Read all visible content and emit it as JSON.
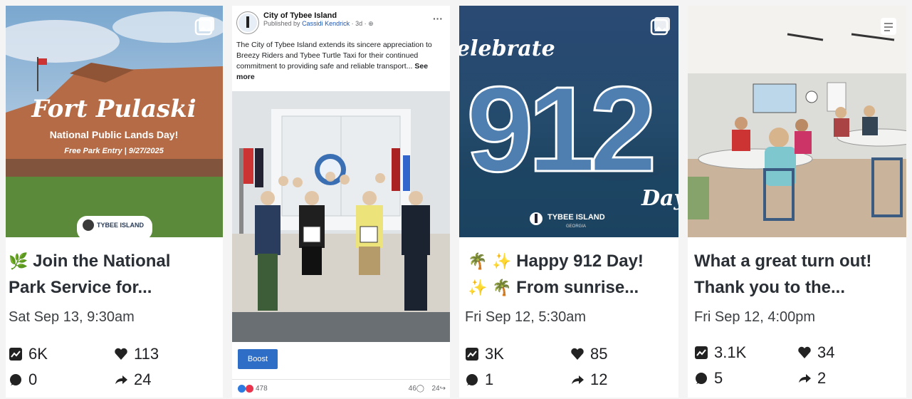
{
  "cards": [
    {
      "image_title": "Fort Pulaski",
      "image_subtitle": "National Public Lands Day!",
      "image_detail": "Free Park Entry | 9/27/2025",
      "logo_text": "TYBEE ISLAND",
      "caption_line1": "Join the National",
      "caption_line2": "Park Service for...",
      "date": "Sat Sep 13, 9:30am",
      "views": "6K",
      "likes": "113",
      "comments": "0",
      "shares": "24"
    },
    {
      "image_title": "elebrate",
      "image_number": "912",
      "image_day": "Day",
      "logo_text": "TYBEE ISLAND",
      "logo_sub": "GEORGIA",
      "caption_line1": "Happy 912 Day!",
      "caption_line2": "From sunrise...",
      "date": "Fri Sep 12, 5:30am",
      "views": "3K",
      "likes": "85",
      "comments": "1",
      "shares": "12"
    },
    {
      "caption_line1": "What a great turn out!",
      "caption_line2": "Thank you to the...",
      "date": "Fri Sep 12, 4:00pm",
      "views": "3.1K",
      "likes": "34",
      "comments": "5",
      "shares": "2"
    }
  ],
  "fb_post": {
    "page_name": "City of Tybee Island",
    "published_prefix": "Published by",
    "author": "Cassidi Kendrick",
    "age": "3d",
    "text": "The City of Tybee Island extends its sincere appreciation to Breezy Riders and Tybee Turtle Taxi for their continued commitment to providing safe and reliable transport...",
    "see_more": "See more",
    "boost_label": "Boost",
    "reactions": "478",
    "comments": "46",
    "shares": "24"
  },
  "colors": {
    "boost": "#2e6ec6",
    "link": "#1a57b8"
  },
  "icons": [
    "gallery-icon",
    "trend-icon",
    "heart-icon",
    "comment-icon",
    "share-icon",
    "leaf-emoji",
    "palm-emoji",
    "sparkle-emoji"
  ]
}
